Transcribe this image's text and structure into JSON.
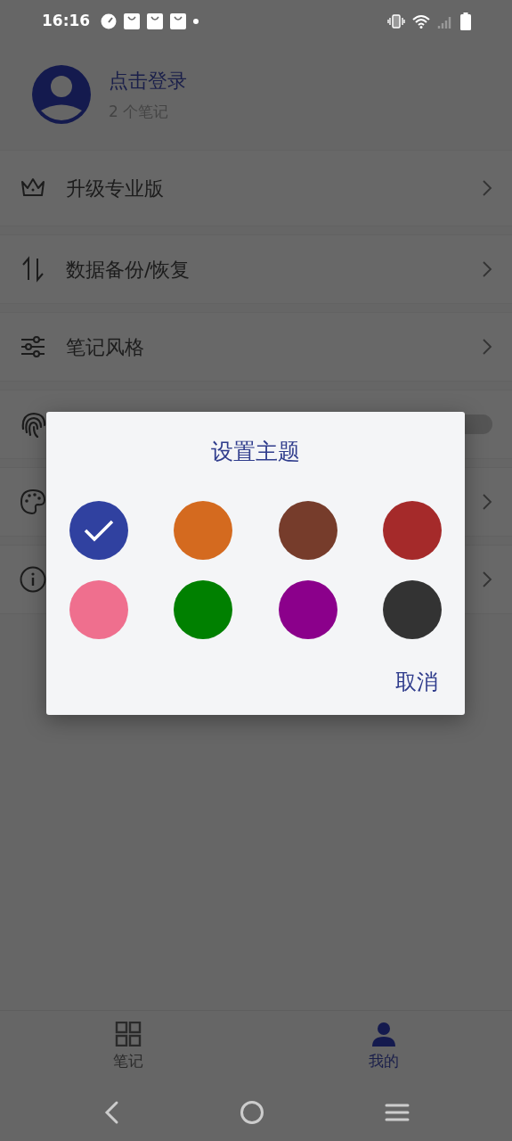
{
  "status_bar": {
    "time": "16:16"
  },
  "profile": {
    "name": "点击登录",
    "subtitle": "2 个笔记"
  },
  "menu": [
    {
      "kind": "link",
      "label": "升级专业版"
    },
    {
      "kind": "link",
      "label": "数据备份/恢复"
    },
    {
      "kind": "link",
      "label": "笔记风格"
    },
    {
      "kind": "toggle",
      "on": false
    },
    {
      "kind": "link"
    },
    {
      "kind": "link"
    }
  ],
  "dialog": {
    "title": "设置主题",
    "colors": [
      {
        "color": "#3041a0",
        "selected": true
      },
      {
        "color": "#d46a1f",
        "selected": false
      },
      {
        "color": "#763c2b",
        "selected": false
      },
      {
        "color": "#a52a2a",
        "selected": false
      },
      {
        "color": "#ef6f8e",
        "selected": false
      },
      {
        "color": "#008000",
        "selected": false
      },
      {
        "color": "#8b008b",
        "selected": false
      },
      {
        "color": "#333333",
        "selected": false
      }
    ],
    "cancel": "取消"
  },
  "bottom_nav": [
    {
      "label": "笔记",
      "selected": false
    },
    {
      "label": "我的",
      "selected": true
    }
  ]
}
